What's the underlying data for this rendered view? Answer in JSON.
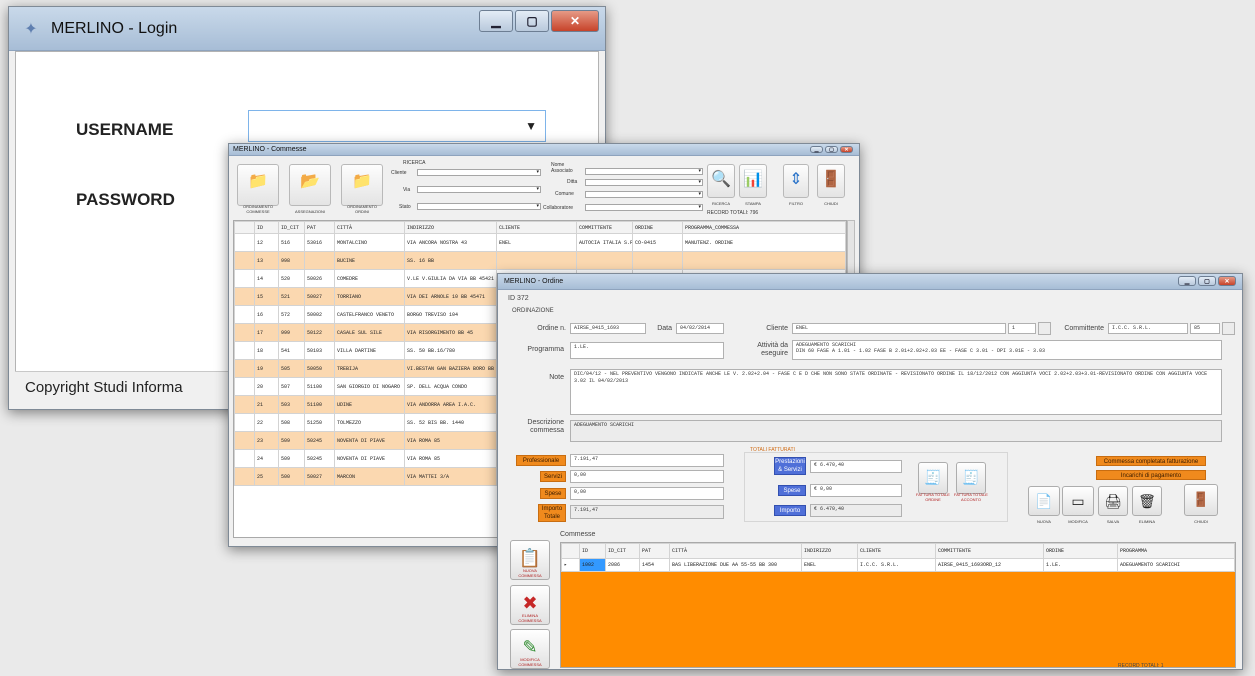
{
  "login": {
    "title": "MERLINO - Login",
    "app_icon": "merlino-app-icon",
    "username_label": "USERNAME",
    "password_label": "PASSWORD",
    "username_value": "",
    "copyright": "Copyright Studi Informa"
  },
  "commesse": {
    "title": "MERLINO - Commesse",
    "toolbar_buttons": [
      "ORDINAMENTO COMMESSE",
      "ASSEGNAZIONI",
      "ORDINAMENTO ORDINI"
    ],
    "filter_group": "RICERCA",
    "filters_left": [
      "Cliente",
      "Via",
      "Stato"
    ],
    "filters_right": [
      "Ditta",
      "Comune",
      "Collaboratore"
    ],
    "filters_right_top": "Nome Associato",
    "action_buttons": [
      "RICERCA",
      "STAMPA",
      "FILTRO",
      "CHIUDI"
    ],
    "record_count": "RECORD TOTALI: 796",
    "columns": [
      "ID",
      "ID_CIT",
      "PAT",
      "CITTÀ",
      "INDIRIZZO",
      "CLIENTE",
      "COMMITTENTE",
      "ORDINE",
      "PROGRAMMA_COMMESSA"
    ],
    "rows": [
      {
        "id": "12",
        "cit": "516",
        "pat": "53016",
        "citta": "MONTALCINO",
        "indirizzo": "VIA ANCORA NOSTRA 43",
        "cliente": "ENEL",
        "committente": "AUTOCIA ITALIA S.P.A.",
        "ordine": "CO-0415",
        "programma": "MANUTENZ. ORDINE",
        "orange": false
      },
      {
        "id": "13",
        "cit": "998",
        "pat": "",
        "citta": "BUCINE",
        "indirizzo": "SS. 16 BB",
        "cliente": "",
        "committente": "",
        "ordine": "",
        "programma": "",
        "orange": true
      },
      {
        "id": "14",
        "cit": "520",
        "pat": "50026",
        "citta": "COMEDRE",
        "indirizzo": "V.LE V.GIULIA DA VIA BB 45421",
        "cliente": "",
        "committente": "",
        "ordine": "",
        "programma": "",
        "orange": false
      },
      {
        "id": "15",
        "cit": "521",
        "pat": "50027",
        "citta": "TORRIANO",
        "indirizzo": "VIA DEI ARNOLE 10 BB 45471",
        "cliente": "",
        "committente": "",
        "ordine": "",
        "programma": "",
        "orange": true
      },
      {
        "id": "16",
        "cit": "572",
        "pat": "50002",
        "citta": "CASTELFRANCO VENETO",
        "indirizzo": "BORGO TREVISO 104",
        "cliente": "",
        "committente": "",
        "ordine": "",
        "programma": "",
        "orange": false
      },
      {
        "id": "17",
        "cit": "999",
        "pat": "50122",
        "citta": "CASALE SUL SILE",
        "indirizzo": "VIA RISORGIMENTO BB 45",
        "cliente": "",
        "committente": "",
        "ordine": "",
        "programma": "",
        "orange": true
      },
      {
        "id": "18",
        "cit": "541",
        "pat": "50103",
        "citta": "VILLA DARTINE",
        "indirizzo": "SS. 50 BB.16/780",
        "cliente": "",
        "committente": "",
        "ordine": "",
        "programma": "",
        "orange": false
      },
      {
        "id": "19",
        "cit": "505",
        "pat": "50050",
        "citta": "TREBIJA",
        "indirizzo": "VI.BESTAN GAN BAZIERA BORO BB",
        "cliente": "",
        "committente": "",
        "ordine": "",
        "programma": "",
        "orange": true
      },
      {
        "id": "20",
        "cit": "507",
        "pat": "51100",
        "citta": "SAN GIORGIO DI NOGARO",
        "indirizzo": "SP. DELL ACQUA CONDO",
        "cliente": "",
        "committente": "",
        "ordine": "",
        "programma": "",
        "orange": false
      },
      {
        "id": "21",
        "cit": "503",
        "pat": "51100",
        "citta": "UDINE",
        "indirizzo": "VIA ANDORRA AREA I.A.C.",
        "cliente": "",
        "committente": "",
        "ordine": "",
        "programma": "",
        "orange": true
      },
      {
        "id": "22",
        "cit": "508",
        "pat": "51250",
        "citta": "TOLMEZZO",
        "indirizzo": "SS. 52 BIS BB. 1440",
        "cliente": "",
        "committente": "",
        "ordine": "",
        "programma": "",
        "orange": false
      },
      {
        "id": "23",
        "cit": "509",
        "pat": "50245",
        "citta": "NOVENTA DI PIAVE",
        "indirizzo": "VIA ROMA 85",
        "cliente": "",
        "committente": "",
        "ordine": "",
        "programma": "",
        "orange": true
      },
      {
        "id": "24",
        "cit": "509",
        "pat": "50245",
        "citta": "NOVENTA DI PIAVE",
        "indirizzo": "VIA ROMA 85",
        "cliente": "",
        "committente": "",
        "ordine": "",
        "programma": "",
        "orange": false
      },
      {
        "id": "25",
        "cit": "500",
        "pat": "50027",
        "citta": "MARCON",
        "indirizzo": "VIA MATTEI 3/A",
        "cliente": "",
        "committente": "",
        "ordine": "",
        "programma": "",
        "orange": true
      }
    ]
  },
  "ordine": {
    "title": "MERLINO - Ordine",
    "tab_label": "ID 372",
    "section_label": "ORDINAZIONE",
    "ordine_label": "Ordine n.",
    "ordine_value": "AIRSE_0415_1693",
    "data_label": "Data",
    "data_value": "04/02/2014",
    "cliente_label": "Cliente",
    "cliente_value": "ENEL",
    "cliente_index": "1",
    "committente_label": "Committente",
    "committente_value": "I.C.C. S.R.L.",
    "committente_index": "85",
    "programma_label": "Programma",
    "programma_value": "1.LE.",
    "attivita_label": "Attività da eseguire",
    "attivita_value": "ADEGUAMENTO SCARICHI\nDIN 60 FASE A 1.01 - 1.02 FASE B 2.01+2.02+2.03 EE - FASE C 3.01 - DPI 3.01E - 3.03",
    "note_label": "Note",
    "note_value": "DIC/04/12 - NEL PREVENTIVO VENGONO INDICATE ANCHE LE V. 2.02+2.04 - FASE C E D CHE NON SONO STATE ORDINATE - REVISIONATO ORDINE IL 18/12/2012 CON AGGIUNTA VOCI 2.02+2.03+3.01-REVISIONATO ORDINE CON AGGIUNTA VOCE 3.02 IL 04/02/2013",
    "descrizione_label": "Descrizione commessa",
    "descrizione_value": "ADEGUAMENTO SCARICHI",
    "professionale_label": "Professionale",
    "professionale_value": "7.191,47",
    "servizi_label": "Servizi",
    "servizi_value": "0,00",
    "spese_label": "Spese",
    "spese_value": "0,00",
    "importo_label": "Importo Totale",
    "importo_value": "7.191,47",
    "fatturato_group": "TOTALI FATTURATI",
    "prestazioni_label": "Prestazioni & Servizi",
    "prestazioni_value": "€ 6.470,40",
    "spese_fatt_label": "Spese",
    "spese_fatt_value": "€ 0,00",
    "importo_fatt_label": "Importo",
    "importo_fatt_value": "€ 6.470,40",
    "fatt_buttons": [
      "FATTURA TOTALE ORDINE",
      "FATTURA TOTALE ACCONTO"
    ],
    "chk_completa": "Commessa completata fatturazione",
    "chk_incarico": "Incarichi di pagamento",
    "tool_buttons": [
      "NUOVA",
      "MODIFICA",
      "SALVA",
      "ELIMINA",
      "CHIUDI"
    ],
    "grid_title": "Commesse",
    "grid_columns": [
      "",
      "ID",
      "ID_CIT",
      "PAT",
      "CITTÀ",
      "INDIRIZZO",
      "CLIENTE",
      "COMMITTENTE",
      "ORDINE",
      "PROGRAMMA",
      "DESCRIZIONE ORDINE"
    ],
    "grid_row": [
      "▸",
      "1002",
      "2086",
      "1454",
      "BAS LIBERAZIONE DUE AA 55-55 BB 300",
      "ENEL",
      "I.C.C. S.R.L.",
      "AIRSE_0415_1693ORD_12",
      "1.LE.",
      "ADEGUAMENTO SCARICHI"
    ],
    "side_buttons": [
      "NUOVA COMMESSA",
      "ELIMINA COMMESSA",
      "MODIFICA COMMESSA"
    ],
    "record_total": "RECORD TOTALI: 1",
    "colors": {
      "orange": "#ff8c00",
      "orange_label": "#f08a1d"
    }
  }
}
